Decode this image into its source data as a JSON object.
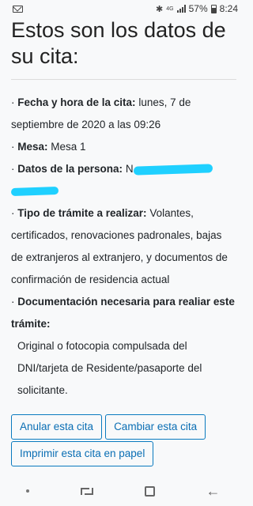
{
  "status_bar": {
    "network": "4G",
    "battery_percent": "57%",
    "time": "8:24"
  },
  "page": {
    "title": "Estos son los datos de su cita:"
  },
  "appointment": {
    "date_label": "Fecha y hora de la cita:",
    "date_value": "lunes, 7 de septiembre de 2020 a las 09:26",
    "desk_label": "Mesa:",
    "desk_value": "Mesa 1",
    "person_label": "Datos de la persona:",
    "person_value_visible": "N",
    "procedure_label": "Tipo de trámite a realizar:",
    "procedure_value": "Volantes, certificados, renovaciones padronales, bajas de extranjeros al extranjero, y documentos de confirmación de residencia actual",
    "docs_label": "Documentación necesaria para realiar este trámite:",
    "docs_value": "Original o fotocopia compulsada del DNI/tarjeta de Residente/pasaporte del solicitante."
  },
  "actions": {
    "cancel_label": "Anular esta cita",
    "change_label": "Cambiar esta cita",
    "print_label": "Imprimir esta cita en papel"
  },
  "colors": {
    "accent": "#0a6eb4",
    "redaction": "#1fd0ff",
    "background": "#f8f9fa"
  }
}
